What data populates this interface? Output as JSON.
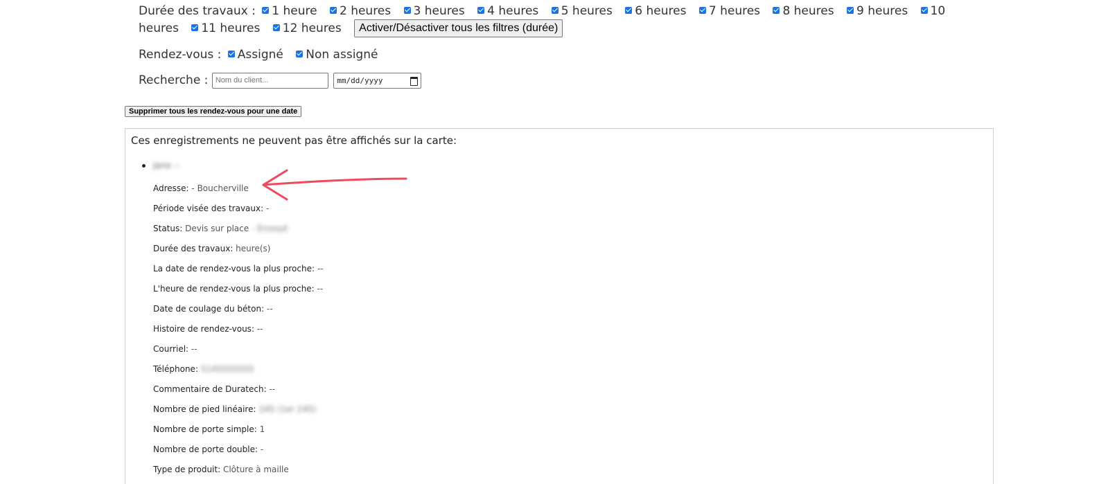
{
  "filters": {
    "duration": {
      "label": "Durée des travaux :",
      "options": [
        "1 heure",
        "2 heures",
        "3 heures",
        "4 heures",
        "5 heures",
        "6 heures",
        "7 heures",
        "8 heures",
        "9 heures",
        "10 heures",
        "11 heures",
        "12 heures"
      ],
      "toggle_button": "Activer/Désactiver tous les filtres (durée)"
    },
    "appointment": {
      "label": "Rendez-vous :",
      "options": [
        "Assigné",
        "Non assigné"
      ]
    },
    "search": {
      "label": "Recherche :",
      "name_placeholder": "Nom du client...",
      "date_placeholder": "mm/dd/yyyy"
    }
  },
  "delete_button": "Supprimer tous les rendez-vous pour une date",
  "panel": {
    "heading": "Ces enregistrements ne peuvent pas être affichés sur la carte:",
    "record": {
      "name": "Jane --",
      "fields": [
        {
          "label": "Adresse:",
          "value": " - Boucherville",
          "blurred": ""
        },
        {
          "label": "Période visée des travaux:",
          "value": " -",
          "blurred": ""
        },
        {
          "label": "Status:",
          "value": " Devis sur place",
          "blurred": "- Envoyé"
        },
        {
          "label": "Durée des travaux:",
          "value": " heure(s)",
          "blurred": ""
        },
        {
          "label": "La date de rendez-vous la plus proche:",
          "value": " --",
          "blurred": ""
        },
        {
          "label": "L'heure de rendez-vous la plus proche:",
          "value": " --",
          "blurred": ""
        },
        {
          "label": "Date de coulage du béton:",
          "value": " --",
          "blurred": ""
        },
        {
          "label": "Histoire de rendez-vous:",
          "value": " --",
          "blurred": ""
        },
        {
          "label": "Courriel:",
          "value": " --",
          "blurred": ""
        },
        {
          "label": "Téléphone:",
          "value": "",
          "blurred": "5145555555"
        },
        {
          "label": "Commentaire de Duratech:",
          "value": " --",
          "blurred": ""
        },
        {
          "label": "Nombre de pied linéaire:",
          "value": "",
          "blurred": "245 (1er 245)"
        },
        {
          "label": "Nombre de porte simple:",
          "value": " 1",
          "blurred": ""
        },
        {
          "label": "Nombre de porte double:",
          "value": " -",
          "blurred": ""
        },
        {
          "label": "Type de produit:",
          "value": " Clôture à maille",
          "blurred": ""
        }
      ]
    }
  },
  "colors": {
    "checkbox": "#1a73e8",
    "arrow": "#f0485e"
  }
}
